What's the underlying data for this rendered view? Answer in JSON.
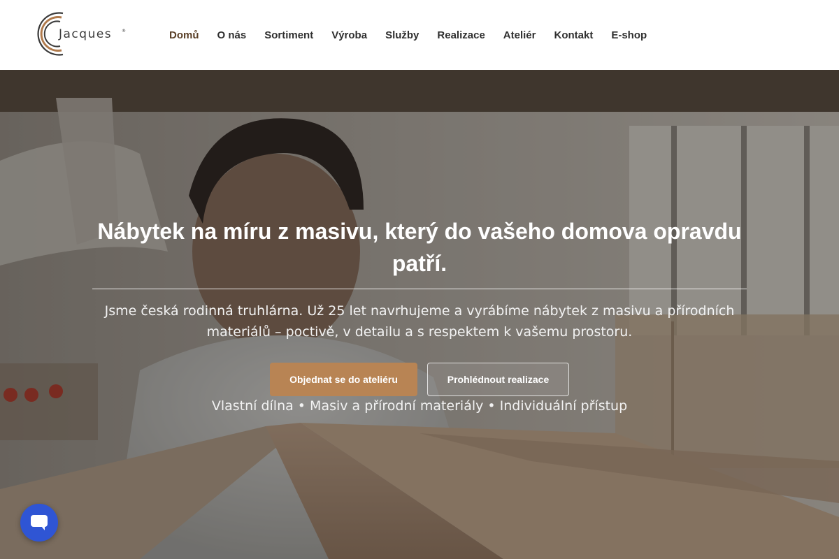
{
  "header": {
    "logo_text": "Jacques",
    "logo_icon": "jacques-c-logo-icon",
    "nav": [
      {
        "label": "Domů",
        "active": true
      },
      {
        "label": "O nás",
        "active": false
      },
      {
        "label": "Sortiment",
        "active": false
      },
      {
        "label": "Výroba",
        "active": false
      },
      {
        "label": "Služby",
        "active": false
      },
      {
        "label": "Realizace",
        "active": false
      },
      {
        "label": "Ateliér",
        "active": false
      },
      {
        "label": "Kontakt",
        "active": false
      },
      {
        "label": "E-shop",
        "active": false
      }
    ]
  },
  "hero": {
    "title": "Nábytek na míru z masivu, který do vašeho domova opravdu patří.",
    "subtitle": "Jsme česká rodinná truhlárna. Už 25 let navrhujeme a vyrábíme nábytek z masivu a přírodních materiálů – poctivě, v detailu a s respektem k vašemu prostoru.",
    "primary_button": "Objednat se do ateliéru",
    "secondary_button": "Prohlédnout realizace",
    "tagline": "Vlastní dílna • Masiv a přírodní materiály • Individuální přístup",
    "background_image": "craftsman-in-workshop-photo"
  },
  "chat_widget": {
    "icon": "chat-bubble-icon"
  },
  "colors": {
    "accent": "#b88454",
    "nav_text": "#2f2f2f",
    "nav_active": "#5a3f27",
    "chat_button": "#2f55d4",
    "logo_copper": "#b07a4c",
    "logo_dark": "#3b3b3b"
  }
}
